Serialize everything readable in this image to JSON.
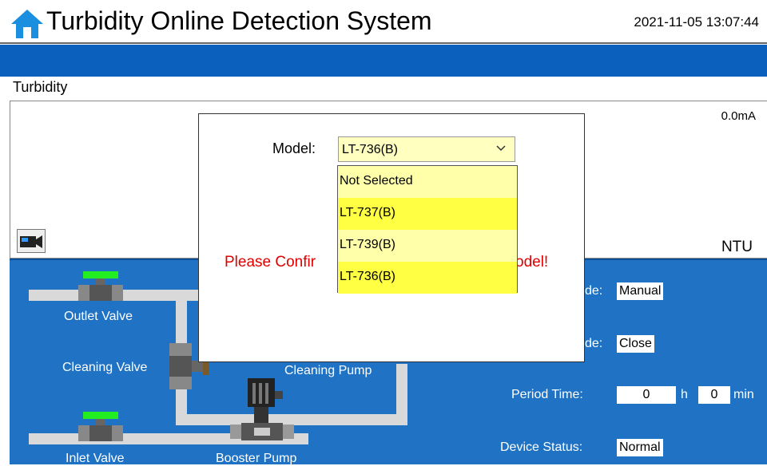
{
  "header": {
    "title": "Turbidity Online Detection System",
    "datetime": "2021-11-05 13:07:44"
  },
  "section": {
    "title": "Turbidity",
    "current_reading": "0.0mA",
    "unit": "NTU"
  },
  "process": {
    "outlet_valve": "Outlet Valve",
    "cleaning_valve": "Cleaning Valve",
    "cleaning_pump": "Cleaning Pump",
    "inlet_valve": "Inlet Valve",
    "booster_pump": "Booster Pump",
    "mode_label_partial": "de:",
    "mode_value": "Manual",
    "mode2_label_partial": "de:",
    "mode2_value": "Close",
    "period_label": "Period Time:",
    "period_hours": "0",
    "period_h": "h",
    "period_minutes": "0",
    "period_min": "min",
    "device_status_label": "Device Status:",
    "device_status_value": "Normal"
  },
  "dialog": {
    "model_label": "Model:",
    "model_selected": "LT-736(B)",
    "confirm_left": "Please Confir",
    "confirm_right": "odel!",
    "options": [
      "Not Selected",
      "LT-737(B)",
      "LT-739(B)",
      "LT-736(B)"
    ]
  },
  "colors": {
    "header_blue": "#0b5fbd",
    "process_blue": "#1f72c4",
    "valve_green": "#22ee22",
    "warning_red": "#e00000",
    "dropdown_yellow": "#ffff66"
  }
}
